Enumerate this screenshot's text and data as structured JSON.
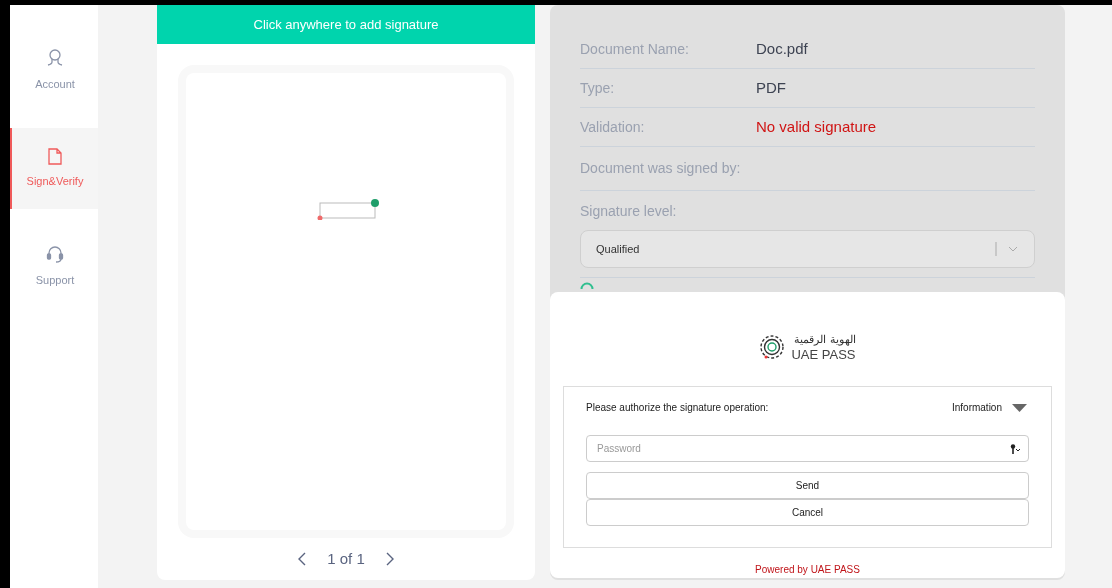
{
  "sidebar": {
    "items": [
      {
        "kind": "account",
        "label": "Account",
        "selected": false
      },
      {
        "kind": "document",
        "label": "Sign&Verify",
        "selected": true
      },
      {
        "kind": "support",
        "label": "Support",
        "selected": false
      }
    ]
  },
  "document_viewer": {
    "banner": "Click anywhere to add signature",
    "pagination": {
      "text": "1 of 1"
    }
  },
  "details": {
    "rows": [
      {
        "label": "Document Name:",
        "value": "Doc.pdf",
        "kind": "normal"
      },
      {
        "label": "Type:",
        "value": "PDF",
        "kind": "normal"
      },
      {
        "label": "Validation:",
        "value": "No valid signature",
        "kind": "error"
      },
      {
        "label": "Document was signed by:"
      }
    ],
    "signature_level": {
      "label": "Signature level:",
      "value": "Qualified"
    }
  },
  "auth_dialog": {
    "logo_arabic": "الهوية الرقمية",
    "logo_text": "UAE PASS",
    "prompt": "Please authorize the signature operation:",
    "info_label": "Information",
    "password": {
      "placeholder": "Password"
    },
    "buttons": [
      "Send",
      "Cancel"
    ],
    "footer": "Powered by UAE PASS"
  }
}
